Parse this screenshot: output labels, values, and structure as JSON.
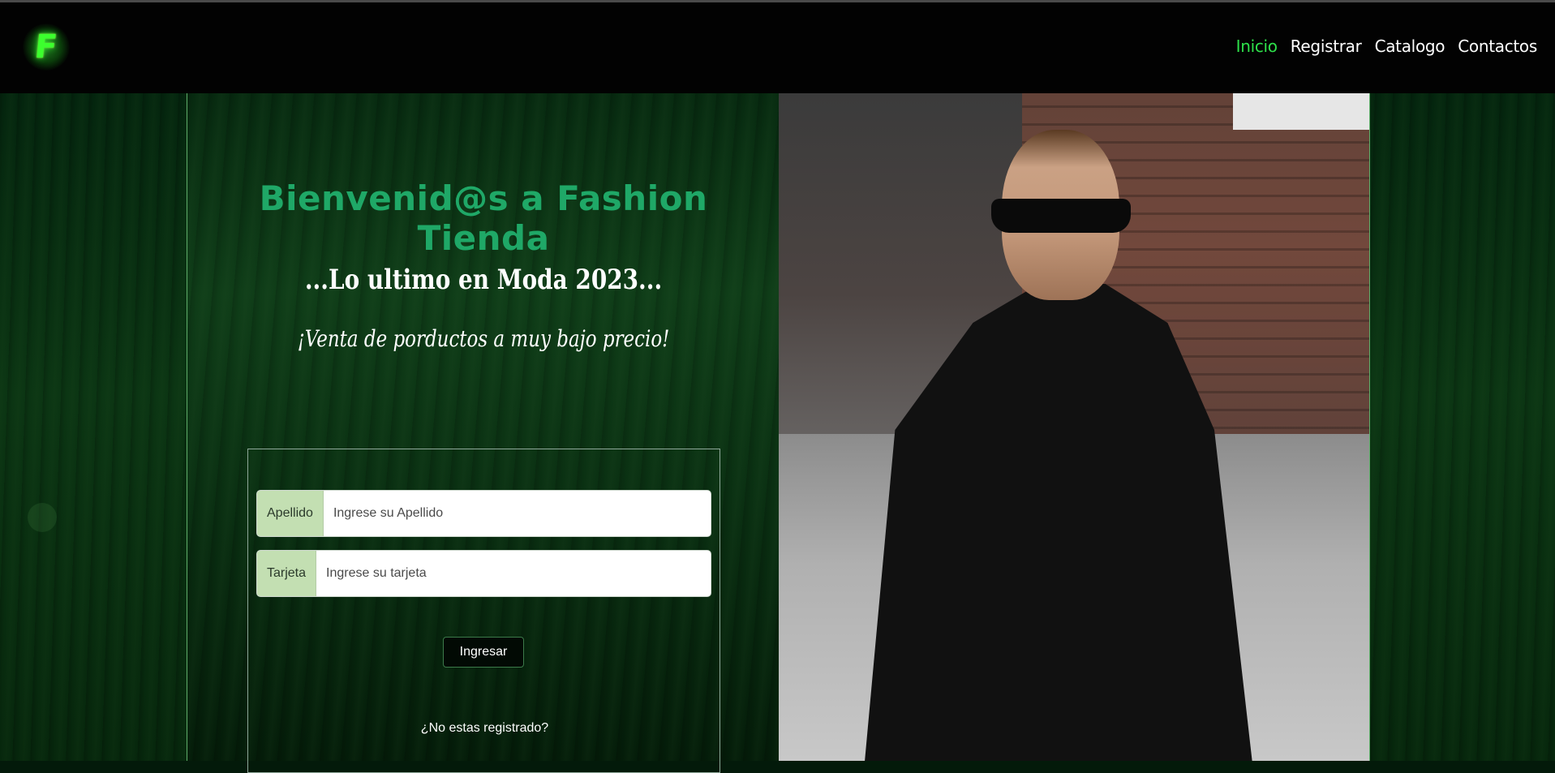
{
  "navbar": {
    "logo_letter": "F",
    "links": [
      {
        "label": "Inicio",
        "active": true
      },
      {
        "label": "Registrar",
        "active": false
      },
      {
        "label": "Catalogo",
        "active": false
      },
      {
        "label": "Contactos",
        "active": false
      }
    ]
  },
  "hero": {
    "title": "Bienvenid@s a Fashion Tienda",
    "subtitle": "...Lo ultimo en Moda 2023...",
    "tagline": "¡Venta de porductos a muy bajo precio!"
  },
  "form": {
    "apellido_label": "Apellido",
    "apellido_placeholder": "Ingrese su Apellido",
    "tarjeta_label": "Tarjeta",
    "tarjeta_placeholder": "Ingrese su tarjeta",
    "submit_label": "Ingresar",
    "register_link": "¿No estas registrado?"
  },
  "colors": {
    "accent_green": "#2ee04a",
    "title_green": "#1fa867",
    "addon_bg": "#c3dfb2"
  }
}
